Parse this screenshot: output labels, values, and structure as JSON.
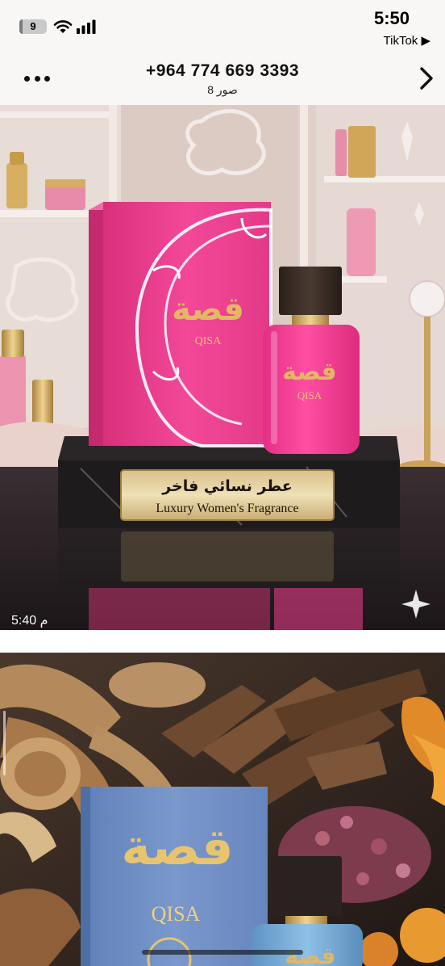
{
  "status_bar": {
    "battery": "9",
    "battery_level": 0.09,
    "time": "5:50",
    "back_app": "TikTok ▶"
  },
  "header": {
    "title": "+964 774 669 3393",
    "subtitle": "8 صور",
    "more_icon": "more-horizontal-icon",
    "forward_icon": "chevron-right-icon"
  },
  "photos": [
    {
      "timestamp": "5:40 م",
      "box_text_ar": "قصة",
      "box_text_en": "QISA",
      "bottle_text_ar": "قصة",
      "bottle_text_en": "QISA",
      "plaque_ar": "عطر نسائي فاخر",
      "plaque_en": "Luxury Women's Fragrance"
    },
    {
      "box_text_ar": "قصة",
      "box_text_en": "QISA",
      "bottle_text_ar": "قصة"
    }
  ],
  "colors": {
    "accent_pink": "#ee3d8f",
    "gold": "#c9a35b",
    "blue_box": "#6f8fc4"
  }
}
